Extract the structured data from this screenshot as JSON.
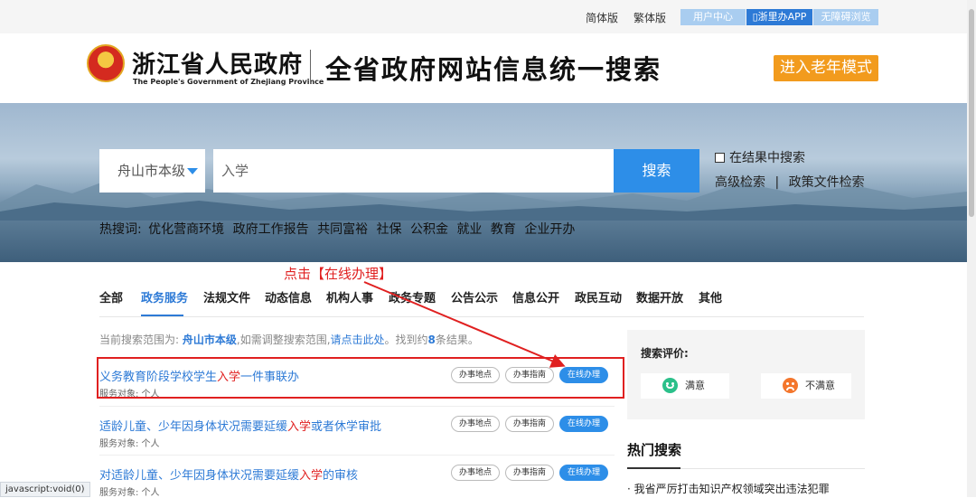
{
  "topbar": {
    "simplified": "简体版",
    "traditional": "繁体版",
    "user_center": "用户中心",
    "app": "浙里办APP",
    "accessible": "无障碍浏览"
  },
  "header": {
    "gov_name": "浙江省人民政府",
    "gov_en": "The People's Government of Zhejiang Province",
    "site_title": "全省政府网站信息统一搜索",
    "elder_mode": "进入老年模式"
  },
  "search": {
    "region": "舟山市本级",
    "query": "入学",
    "button": "搜索",
    "in_results": "在结果中搜索",
    "advanced": "高级检索",
    "separator": "|",
    "policy": "政策文件检索",
    "hot_label": "热搜词:",
    "hot_words": [
      "优化营商环境",
      "政府工作报告",
      "共同富裕",
      "社保",
      "公积金",
      "就业",
      "教育",
      "企业开办"
    ]
  },
  "annotation": "点击【在线办理】",
  "tabs": [
    "全部",
    "政务服务",
    "法规文件",
    "动态信息",
    "机构人事",
    "政务专题",
    "公告公示",
    "信息公开",
    "政民互动",
    "数据开放",
    "其他"
  ],
  "active_tab": "政务服务",
  "scope": {
    "prefix": "当前搜索范围为: ",
    "region": "舟山市本级",
    "middle": ",如需调整搜索范围,",
    "link": "请点击此处",
    "found_prefix": "。找到约",
    "count": "8",
    "found_suffix": "条结果。"
  },
  "results": [
    {
      "pre": "义务教育阶段学校学生",
      "hl": "入学",
      "post": "一件事联办",
      "obj": "服务对象: 个人"
    },
    {
      "pre": "适龄儿童、少年因身体状况需要延缓",
      "hl": "入学",
      "post": "或者休学审批",
      "obj": "服务对象: 个人"
    },
    {
      "pre": "对适龄儿童、少年因身体状况需要延缓",
      "hl": "入学",
      "post": "的审核",
      "obj": "服务对象: 个人"
    }
  ],
  "result_buttons": {
    "place": "办事地点",
    "guide": "办事指南",
    "online": "在线办理"
  },
  "evaluation": {
    "label": "搜索评价:",
    "satisfied": "满意",
    "unsatisfied": "不满意"
  },
  "hot_search": {
    "title": "热门搜索",
    "item": "我省严厉打击知识产权领域突出违法犯罪"
  },
  "status_bar": "javascript:void(0)",
  "colors": {
    "accent": "#2d8ee8",
    "link": "#2d7ad6",
    "highlight": "#e02020",
    "elder_button": "#f29b1d"
  }
}
